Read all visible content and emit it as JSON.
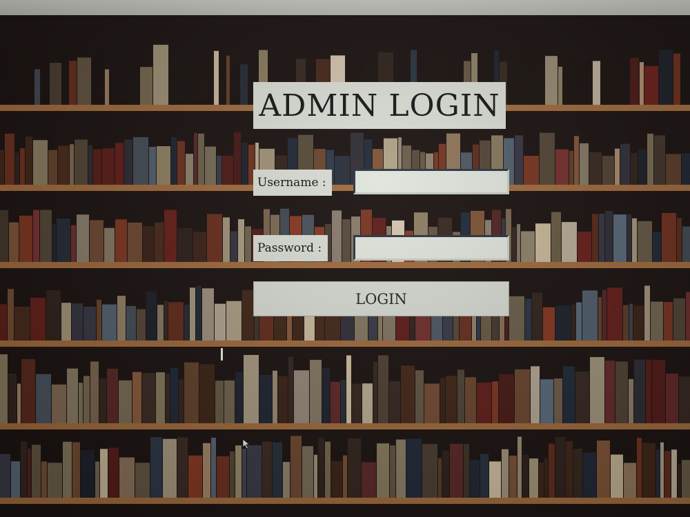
{
  "login": {
    "title": "ADMIN LOGIN",
    "username_label": "Username :",
    "password_label": "Password :",
    "username_value": "",
    "password_value": "",
    "login_button": "LOGIN"
  },
  "background": {
    "icon": "bookshelf-background",
    "shelf_color": "#a06a3c",
    "dark_color": "#1a1210"
  },
  "colors": {
    "panel": "#d8dcd3",
    "field_border": "#2a3340",
    "text": "#161616"
  }
}
